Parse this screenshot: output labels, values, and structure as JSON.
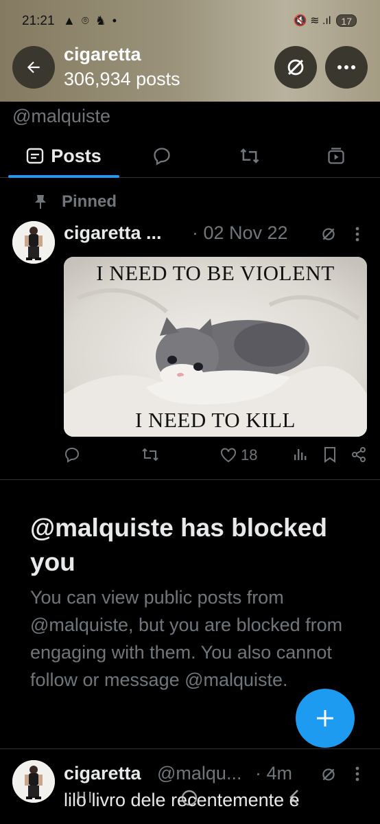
{
  "status_bar": {
    "time": "21:21",
    "left_icons": "▲ ⌾ ♞ •",
    "right_icons": "🔇 ≋ .ıl",
    "battery": "17"
  },
  "header": {
    "title": "cigaretta",
    "post_count": "306,934 posts"
  },
  "profile": {
    "handle": "@malquiste"
  },
  "tabs": [
    {
      "label": "Posts",
      "icon": "posts-tab-icon",
      "active": true
    },
    {
      "label": "",
      "icon": "replies-bubble-icon",
      "active": false
    },
    {
      "label": "",
      "icon": "repost-icon",
      "active": false
    },
    {
      "label": "",
      "icon": "media-video-icon",
      "active": false
    }
  ],
  "pinned_post": {
    "pinned_label": "Pinned",
    "author_name": "cigaretta ...",
    "date": "· 02 Nov 22",
    "image": {
      "top_text": "I NEED TO BE VIOLENT",
      "bottom_text": "I NEED TO KILL"
    },
    "actions": {
      "likes": "18"
    }
  },
  "blocked_notice": {
    "title": "@malquiste has blocked you",
    "body": "You can view public posts from @malquiste, but you are blocked from engaging with them. You also cannot follow or message @malquiste."
  },
  "second_post": {
    "author_name": "cigaretta",
    "handle": "@malqu...",
    "time": "· 4m",
    "text": "lilo livro dele recentemente e"
  },
  "colors": {
    "accent": "#1d9bf0",
    "muted": "#71767b",
    "background": "#000000",
    "header_tint": "#9a927a"
  }
}
